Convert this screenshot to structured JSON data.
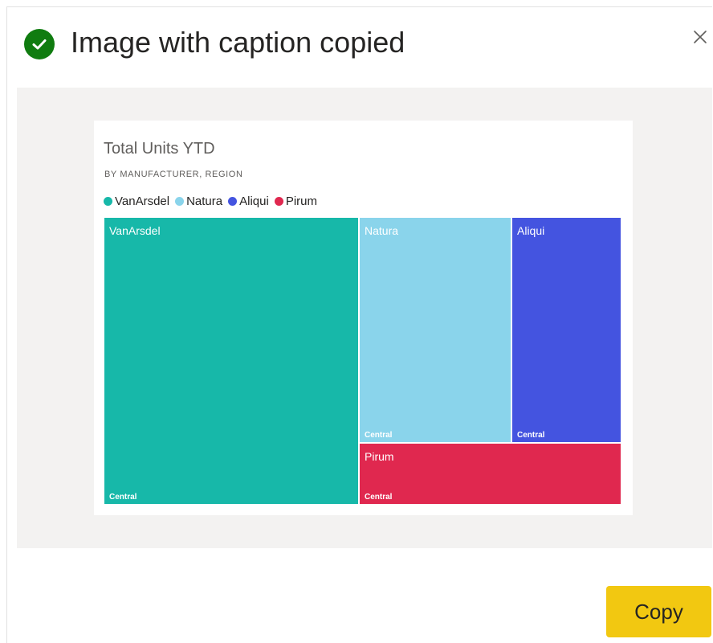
{
  "dialog": {
    "title": "Image with caption copied",
    "success_icon": "checkmark-circle",
    "success_color": "#107c10",
    "close_icon": "close-x",
    "copy_label": "Copy",
    "copy_color": "#f2c811"
  },
  "visual": {
    "title": "Total Units YTD",
    "subtitle": "BY MANUFACTURER, REGION",
    "legend": [
      {
        "label": "VanArsdel",
        "color": "#17b8a9"
      },
      {
        "label": "Natura",
        "color": "#8ad4eb"
      },
      {
        "label": "Aliqui",
        "color": "#4454e0"
      },
      {
        "label": "Pirum",
        "color": "#e0284f"
      }
    ]
  },
  "chart_data": {
    "type": "treemap",
    "title": "Total Units YTD",
    "subtitle": "BY MANUFACTURER, REGION",
    "legend_position": "top-left",
    "groups": [
      {
        "name": "VanArsdel",
        "color": "#17b8a9",
        "children": [
          {
            "name": "Central"
          }
        ]
      },
      {
        "name": "Natura",
        "color": "#8ad4eb",
        "children": [
          {
            "name": "Central"
          }
        ]
      },
      {
        "name": "Aliqui",
        "color": "#4454e0",
        "children": [
          {
            "name": "Central"
          }
        ]
      },
      {
        "name": "Pirum",
        "color": "#e0284f",
        "children": [
          {
            "name": "Central"
          }
        ]
      }
    ]
  }
}
